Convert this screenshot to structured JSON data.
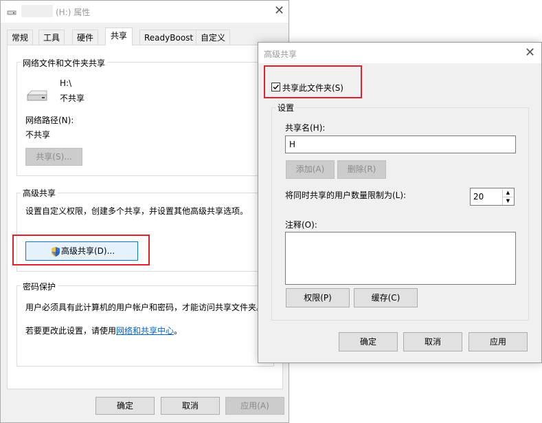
{
  "props": {
    "title": "(H:) 属性",
    "tabs": [
      "常规",
      "工具",
      "硬件",
      "共享",
      "ReadyBoost",
      "自定义"
    ],
    "share_group_title": "网络文件和文件夹共享",
    "drive_path": "H:\\",
    "drive_status": "不共享",
    "network_path_label": "网络路径(N):",
    "network_path_value": "不共享",
    "share_button": "共享(S)...",
    "adv_group_title": "高级共享",
    "adv_desc": "设置自定义权限，创建多个共享，并设置其他高级共享选项。",
    "adv_button": "高级共享(D)...",
    "pwd_group_title": "密码保护",
    "pwd_desc": "用户必须具有此计算机的用户帐户和密码，才能访问共享文件夹。",
    "pwd_change_prefix": "若要更改此设置，请使用",
    "pwd_link": "网络和共享中心",
    "pwd_change_suffix": "。",
    "ok": "确定",
    "cancel": "取消",
    "apply": "应用(A)"
  },
  "advanced": {
    "title": "高级共享",
    "share_checkbox": "共享此文件夹(S)",
    "settings_title": "设置",
    "share_name_label": "共享名(H):",
    "share_name_value": "H",
    "add_button": "添加(A)",
    "remove_button": "删除(R)",
    "limit_label": "将同时共享的用户数量限制为(L):",
    "limit_value": "20",
    "comment_label": "注释(O):",
    "comment_value": "",
    "permissions_button": "权限(P)",
    "cache_button": "缓存(C)",
    "ok": "确定",
    "cancel": "取消",
    "apply": "应用"
  },
  "colors": {
    "highlight_box": "#e0202a",
    "link": "#0066cc",
    "focus_border": "#0078d7"
  }
}
